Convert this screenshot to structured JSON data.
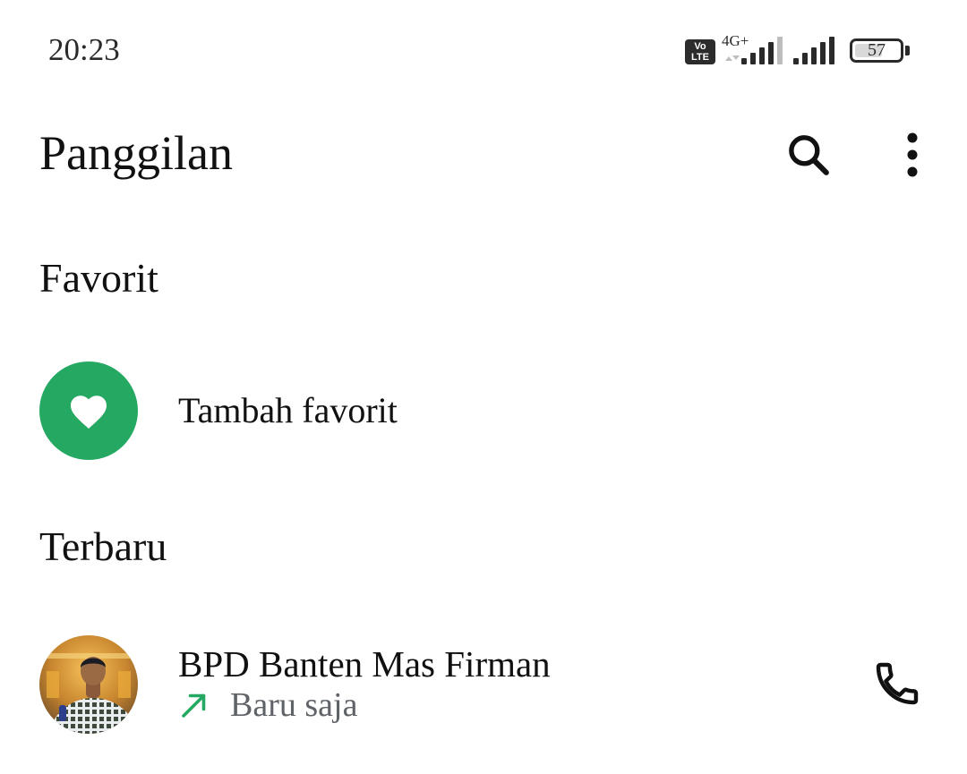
{
  "status_bar": {
    "time": "20:23",
    "volte_top": "Vo",
    "volte_bottom": "LTE",
    "network": "4G+",
    "battery_percent": "57"
  },
  "header": {
    "title": "Panggilan"
  },
  "favorites": {
    "title": "Favorit",
    "add_label": "Tambah favorit"
  },
  "recent": {
    "title": "Terbaru",
    "calls": [
      {
        "name": "BPD Banten Mas Firman",
        "time": "Baru saja",
        "direction": "outgoing"
      }
    ]
  },
  "colors": {
    "accent_green": "#25a862",
    "text_primary": "#111111",
    "text_secondary": "#5f6368"
  },
  "icons": [
    "search-icon",
    "more-vert-icon",
    "heart-icon",
    "outgoing-call-arrow-icon",
    "phone-icon"
  ]
}
